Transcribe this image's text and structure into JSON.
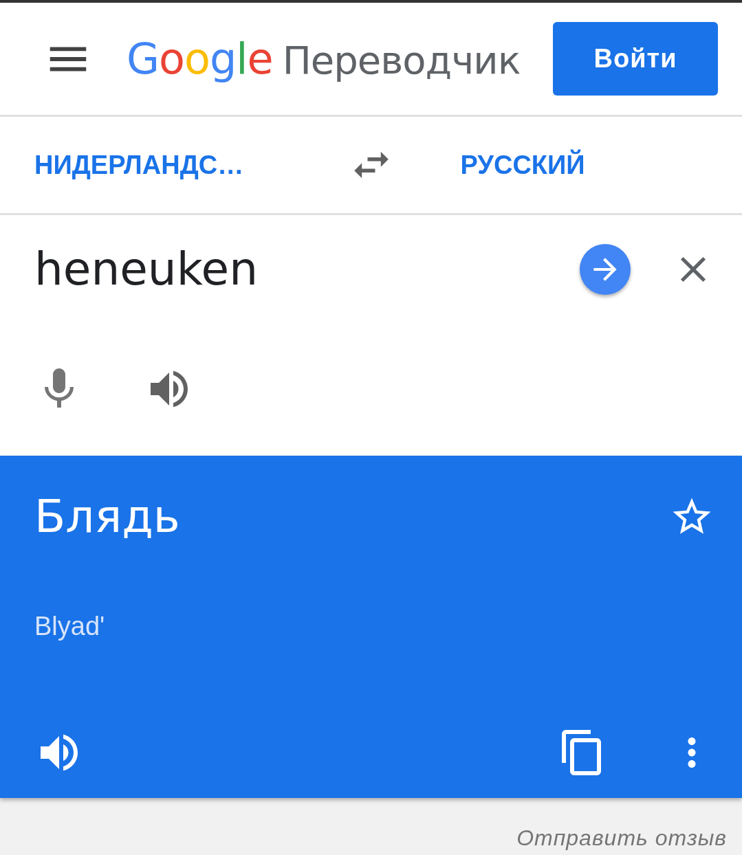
{
  "header": {
    "logo": "Google",
    "product": "Переводчик",
    "sign_in": "Войти"
  },
  "languages": {
    "source": "НИДЕРЛАНДС…",
    "target": "РУССКИЙ"
  },
  "input": {
    "value": "heneuken"
  },
  "result": {
    "translation": "Блядь",
    "transliteration": "Blyad'",
    "starred": false
  },
  "footer": {
    "feedback": "Отправить отзыв"
  }
}
